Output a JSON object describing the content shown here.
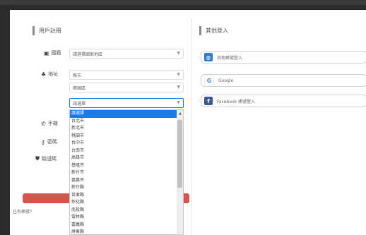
{
  "left_section": {
    "title": "用戶註冊"
  },
  "right_section": {
    "title": "其他登入"
  },
  "form": {
    "rows": {
      "r1_label": "國籍",
      "r1_value": "請選擇國家地區",
      "r2_label": "地址",
      "r2_city": "縣市",
      "r2_district": "鄉鎮區",
      "r2_selected": "請選擇",
      "r3_label": "手機",
      "r4_label": "密碼",
      "r5_label": "驗證碼"
    },
    "dropdown_options": [
      "請選擇",
      "台北市",
      "新北市",
      "桃園市",
      "台中市",
      "台南市",
      "高雄市",
      "基隆市",
      "新竹市",
      "嘉義市",
      "新竹縣",
      "苗栗縣",
      "彰化縣",
      "南投縣",
      "雲林縣",
      "嘉義縣",
      "屏東縣"
    ],
    "selected_option_index": 0,
    "footer_link": "已有帳號?"
  },
  "social_logins": [
    {
      "label": "其他帳號登入",
      "icon": "globe-icon",
      "color": "#2a7bd4"
    },
    {
      "label": "Google",
      "icon": "google-icon",
      "color": "#4285f4"
    },
    {
      "label": "Facebook 帳號登入",
      "icon": "facebook-icon",
      "color": "#3b5998"
    }
  ]
}
